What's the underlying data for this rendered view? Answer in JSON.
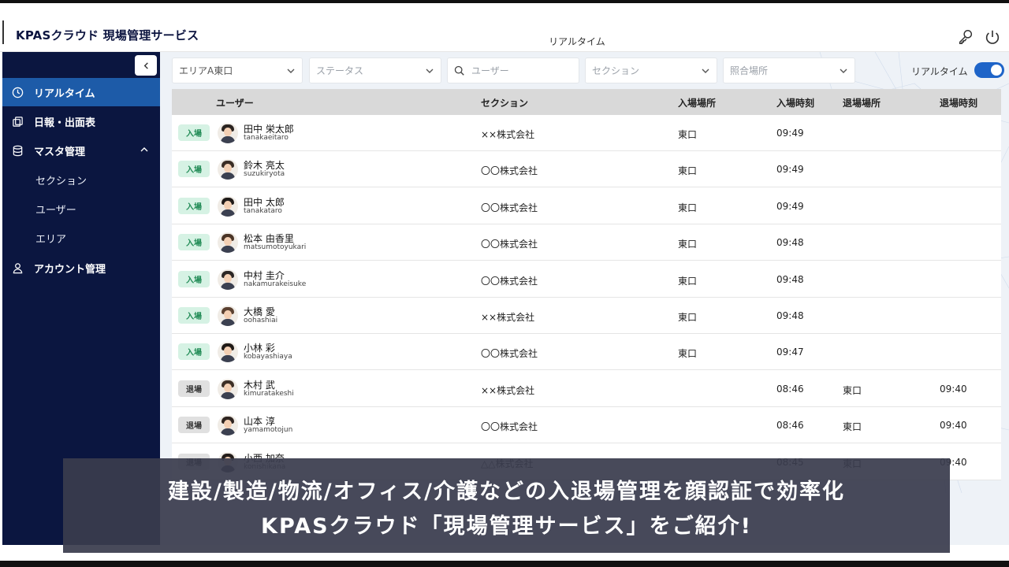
{
  "app": {
    "brand": "KPASクラウド 現場管理サービス",
    "page_title": "リアルタイム"
  },
  "header": {
    "icons": [
      "key-icon",
      "power-icon"
    ]
  },
  "sidebar": {
    "items": [
      {
        "label": "リアルタイム",
        "icon": "clock-icon",
        "active": true
      },
      {
        "label": "日報・出面表",
        "icon": "copy-icon"
      },
      {
        "label": "マスタ管理",
        "icon": "database-icon",
        "expanded": true
      },
      {
        "label": "アカウント管理",
        "icon": "person-icon"
      }
    ],
    "sub_items": [
      {
        "label": "セクション"
      },
      {
        "label": "ユーザー"
      },
      {
        "label": "エリア"
      }
    ]
  },
  "filters": {
    "area": "エリアA東口",
    "status_placeholder": "ステータス",
    "user_placeholder": "ユーザー",
    "section_placeholder": "セクション",
    "location_placeholder": "照合場所",
    "realtime_label": "リアルタイム",
    "realtime_on": true
  },
  "table": {
    "headers": {
      "user": "ユーザー",
      "section": "セクション",
      "entry_place": "入場場所",
      "entry_time": "入場時刻",
      "exit_place": "退場場所",
      "exit_time": "退場時刻"
    },
    "rows": [
      {
        "status": "入場",
        "type": "in",
        "name": "田中 栄太郎",
        "login": "tanakaeitaro",
        "section": "××株式会社",
        "entry_place": "東口",
        "entry_time": "09:49",
        "exit_place": "",
        "exit_time": ""
      },
      {
        "status": "入場",
        "type": "in",
        "name": "鈴木 亮太",
        "login": "suzukiryota",
        "section": "〇〇株式会社",
        "entry_place": "東口",
        "entry_time": "09:49",
        "exit_place": "",
        "exit_time": ""
      },
      {
        "status": "入場",
        "type": "in",
        "name": "田中 太郎",
        "login": "tanakataro",
        "section": "〇〇株式会社",
        "entry_place": "東口",
        "entry_time": "09:49",
        "exit_place": "",
        "exit_time": ""
      },
      {
        "status": "入場",
        "type": "in",
        "name": "松本 由香里",
        "login": "matsumotoyukari",
        "section": "〇〇株式会社",
        "entry_place": "東口",
        "entry_time": "09:48",
        "exit_place": "",
        "exit_time": ""
      },
      {
        "status": "入場",
        "type": "in",
        "name": "中村 圭介",
        "login": "nakamurakeisuke",
        "section": "〇〇株式会社",
        "entry_place": "東口",
        "entry_time": "09:48",
        "exit_place": "",
        "exit_time": ""
      },
      {
        "status": "入場",
        "type": "in",
        "name": "大橋 愛",
        "login": "oohashiai",
        "section": "××株式会社",
        "entry_place": "東口",
        "entry_time": "09:48",
        "exit_place": "",
        "exit_time": ""
      },
      {
        "status": "入場",
        "type": "in",
        "name": "小林 彩",
        "login": "kobayashiaya",
        "section": "〇〇株式会社",
        "entry_place": "東口",
        "entry_time": "09:47",
        "exit_place": "",
        "exit_time": ""
      },
      {
        "status": "退場",
        "type": "out",
        "name": "木村 武",
        "login": "kimuratakeshi",
        "section": "××株式会社",
        "entry_place": "",
        "entry_time": "08:46",
        "exit_place": "東口",
        "exit_time": "09:40"
      },
      {
        "status": "退場",
        "type": "out",
        "name": "山本 淳",
        "login": "yamamotojun",
        "section": "〇〇株式会社",
        "entry_place": "",
        "entry_time": "08:46",
        "exit_place": "東口",
        "exit_time": "09:40"
      },
      {
        "status": "退場",
        "type": "out",
        "name": "小西 加奈",
        "login": "konishikana",
        "section": "△△株式会社",
        "entry_place": "",
        "entry_time": "08:45",
        "exit_place": "東口",
        "exit_time": "09:40"
      }
    ]
  },
  "caption": {
    "line1": "建設/製造/物流/オフィス/介護などの入退場管理を顔認証で効率化",
    "line2": "KPASクラウド「現場管理サービス」をご紹介!"
  },
  "colors": {
    "sidebar_bg": "#0b1640",
    "active_nav": "#1d5ba8",
    "toggle_on": "#1e64c8",
    "badge_in_bg": "#d6f2e4",
    "badge_in_text": "#1f8a54",
    "badge_out_bg": "#e0e0e0"
  }
}
